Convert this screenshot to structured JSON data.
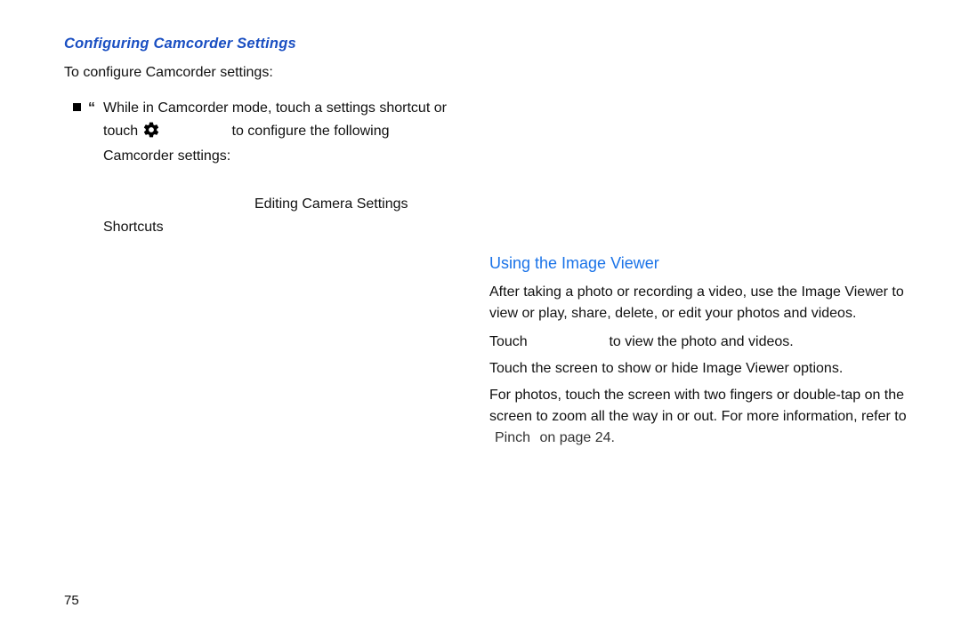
{
  "left": {
    "heading": "Configuring Camcorder Settings",
    "intro": "To configure Camcorder settings:",
    "bullet_line1": "While in Camcorder mode, touch a settings shortcut or",
    "bullet_line2_pre": "touch ",
    "bullet_line2_post": "to configure the following",
    "bullet_line3": "Camcorder settings:",
    "sub_right": "Editing Camera Settings",
    "sub_left": "Shortcuts"
  },
  "right": {
    "heading": "Using the Image Viewer",
    "para1": "After taking a photo or recording a video, use the Image Viewer to view or play, share, delete, or edit your photos and videos.",
    "touch_word": "Touch",
    "touch_rest": "to view the photo and videos.",
    "line3": "Touch the screen to show or hide Image Viewer options.",
    "zoom": "For photos, touch the screen with two fingers or double-tap on the screen to zoom all the way in or out. For more information, refer to ",
    "pinch_label": "Pinch",
    "pinch_rest": " on page 24."
  },
  "page_number": "75"
}
